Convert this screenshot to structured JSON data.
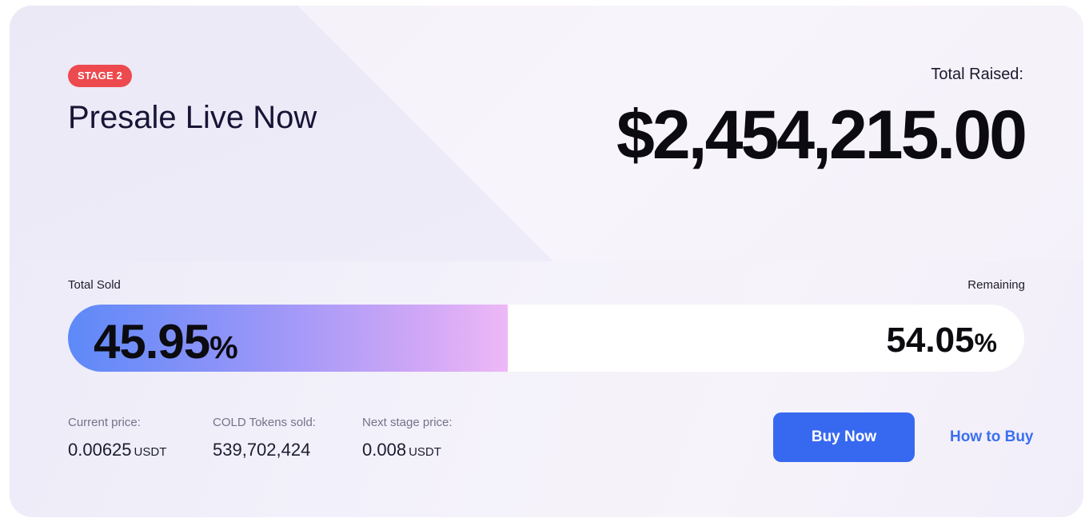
{
  "stage_badge": "STAGE 2",
  "title": "Presale Live Now",
  "total_raised": {
    "label": "Total Raised:",
    "value": "$2,454,215.00"
  },
  "progress": {
    "sold_label": "Total Sold",
    "remaining_label": "Remaining",
    "sold_percent_value": "45.95",
    "sold_percent_unit": "%",
    "remaining_percent_value": "54.05",
    "remaining_percent_unit": "%",
    "sold_fraction": 0.4595
  },
  "stats": [
    {
      "label": "Current price:",
      "value": "0.00625",
      "unit": "USDT"
    },
    {
      "label": "COLD Tokens sold:",
      "value": "539,702,424",
      "unit": ""
    },
    {
      "label": "Next stage price:",
      "value": "0.008",
      "unit": "USDT"
    }
  ],
  "actions": {
    "buy_label": "Buy Now",
    "how_label": "How to Buy"
  },
  "colors": {
    "badge": "#ec4a4f",
    "accent": "#3769f0",
    "bar_gradient_start": "#5d89f8",
    "bar_gradient_end": "#eeb8f6"
  }
}
